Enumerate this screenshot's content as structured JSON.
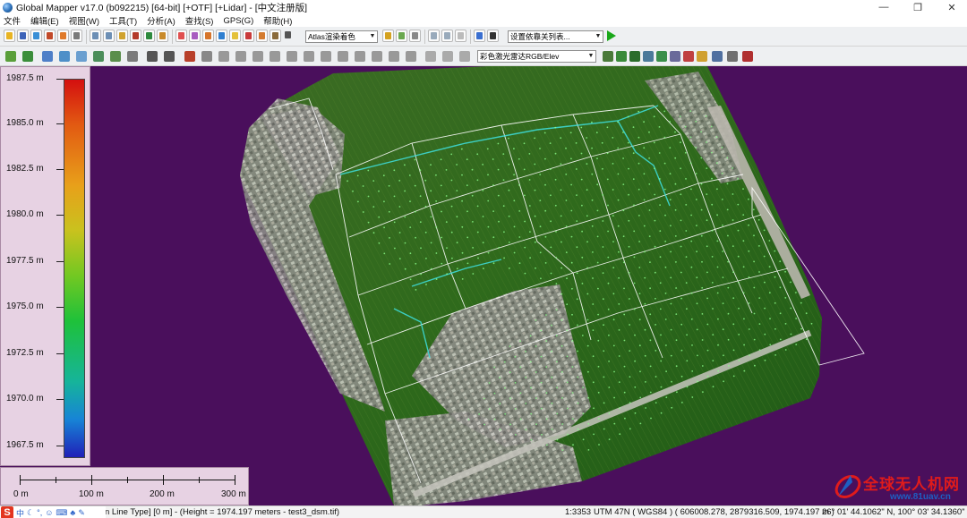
{
  "window": {
    "title": "Global Mapper v17.0 (b092215) [64-bit] [+OTF] [+Lidar] - [中文注册版]",
    "controls": [
      "—",
      "❐",
      "✕"
    ]
  },
  "menu": [
    "文件",
    "编辑(E)",
    "视图(W)",
    "工具(T)",
    "分析(A)",
    "查找(S)",
    "GPS(G)",
    "帮助(H)"
  ],
  "toolbar1": {
    "shader_combo": "Atlas渲染着色",
    "layer_combo": "设置依靠关列表..."
  },
  "toolbar2": {
    "render_combo": "彩色激光雷达RGB/Elev"
  },
  "legend": {
    "labels": [
      "1987.5 m",
      "1985.0 m",
      "1982.5 m",
      "1980.0 m",
      "1977.5 m",
      "1975.0 m",
      "1972.5 m",
      "1970.0 m",
      "1967.5 m"
    ],
    "max": 1987.5,
    "min": 1967.5
  },
  "scale": {
    "labels": [
      "0 m",
      "100 m",
      "200 m",
      "300 m"
    ]
  },
  "status": {
    "left": "n Line Type] [0 m] - (Height = 1974.197 meters - test3_dsm.tif)",
    "scale": "1:3353",
    "projection": "UTM 47N ( WGS84 ) ( 606008.278, 2879316.509, 1974.197 m )",
    "coords": "26° 01' 44.1062\" N, 100° 03' 34.1360\" E"
  },
  "watermark": {
    "title": "全球无人机网",
    "url": "www.81uav.cn"
  },
  "colors": {
    "map_background": "#4a0f5c",
    "legend_panel": "#e7d2e3",
    "vector_lines": "#ffffff",
    "water_lines": "#3ee0e0",
    "point_marks": "#8cff8c"
  }
}
